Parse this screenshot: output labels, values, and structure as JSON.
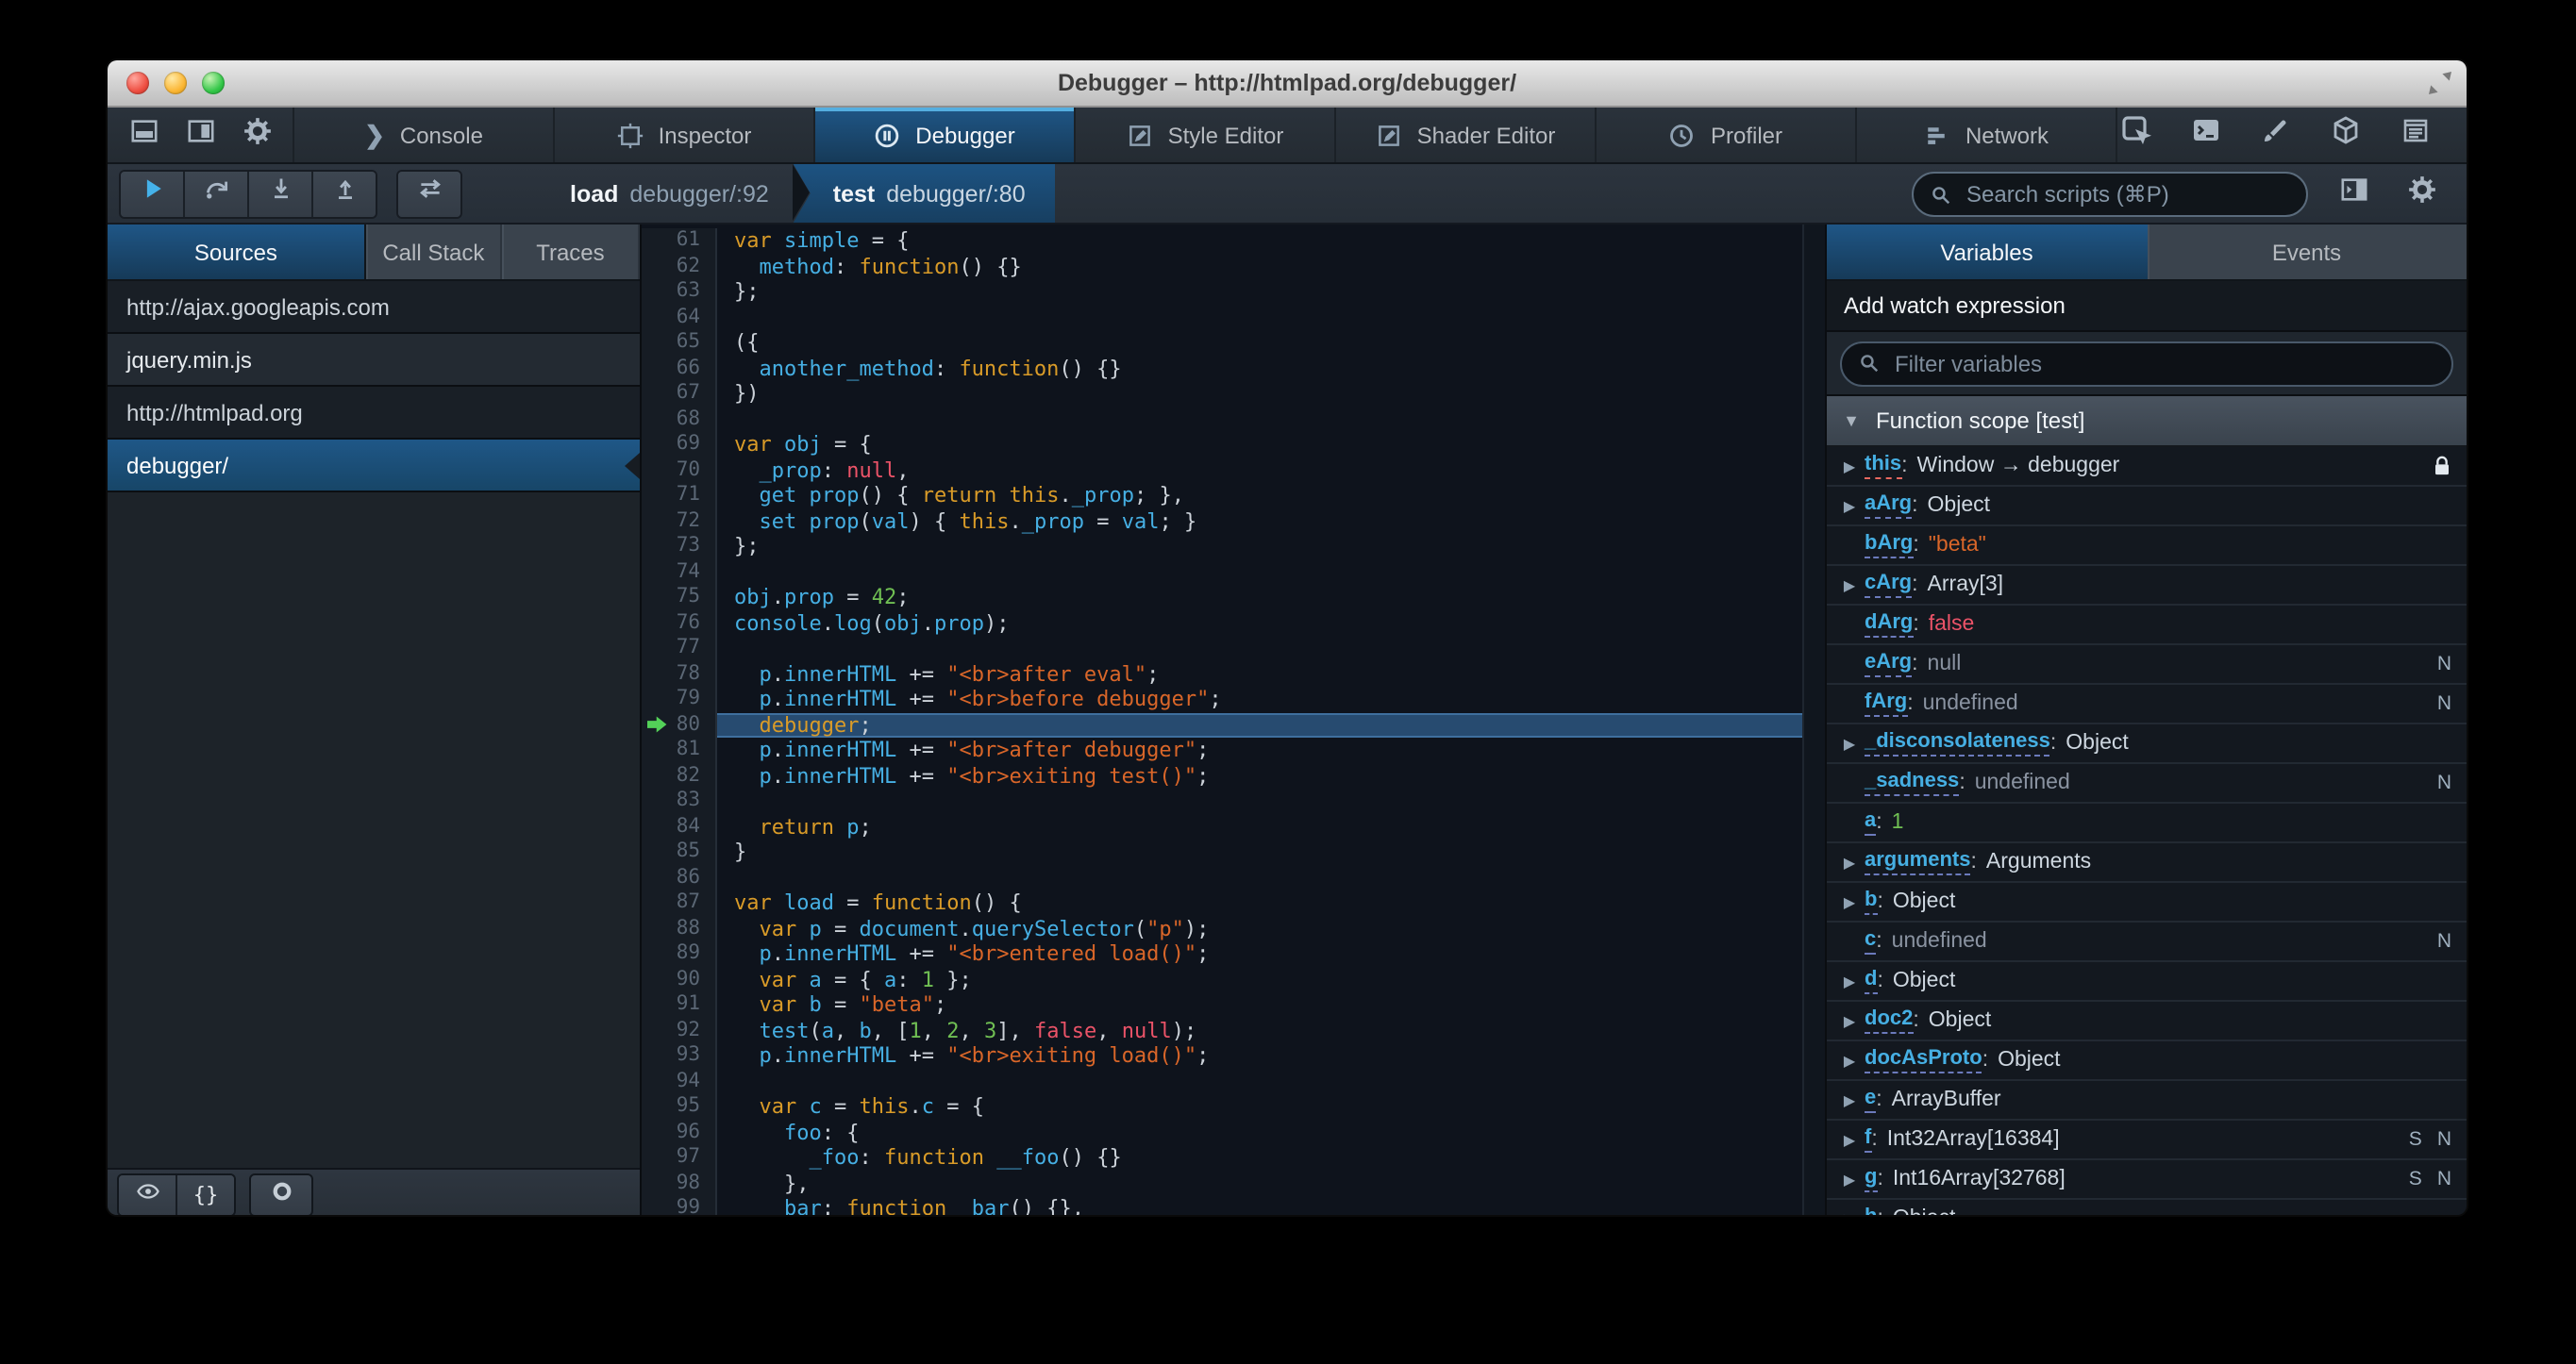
{
  "window": {
    "title": "Debugger – http://htmlpad.org/debugger/",
    "controls": [
      "close",
      "minimize",
      "zoom"
    ]
  },
  "colors": {
    "accent_blue": "#46afe3",
    "selection_blue": "#1d4f73",
    "keyword": "#d99b28",
    "string": "#d96629",
    "number": "#70bf53",
    "atom_red": "#eb5368",
    "ui_text": "#b6babf",
    "exec_arrow_green": "#53d158",
    "toolbar_bg": "#252c33",
    "editor_bg": "#0e131c"
  },
  "toolbar": {
    "left_icons": [
      "dock-bottom-icon",
      "dock-side-icon",
      "gear-icon"
    ],
    "tabs": [
      {
        "label": "Console",
        "icon": "console-icon"
      },
      {
        "label": "Inspector",
        "icon": "inspector-icon"
      },
      {
        "label": "Debugger",
        "icon": "debugger-icon"
      },
      {
        "label": "Style Editor",
        "icon": "style-editor-icon"
      },
      {
        "label": "Shader Editor",
        "icon": "shader-editor-icon"
      },
      {
        "label": "Profiler",
        "icon": "profiler-icon"
      },
      {
        "label": "Network",
        "icon": "network-icon"
      }
    ],
    "active_tab": "Debugger",
    "right_icons": [
      "pick-element-icon",
      "console-panel-icon",
      "paintbrush-icon",
      "tilt-3d-icon",
      "scratchpad-icon",
      "responsive-mode-icon"
    ]
  },
  "debugger_toolbar": {
    "buttons": [
      {
        "name": "resume-button",
        "icon": "resume-icon"
      },
      {
        "name": "step-over-button",
        "icon": "step-over-icon"
      },
      {
        "name": "step-in-button",
        "icon": "step-in-icon"
      },
      {
        "name": "step-out-button",
        "icon": "step-out-icon"
      }
    ],
    "trace_button": {
      "name": "trace-button",
      "icon": "trace-icon"
    },
    "breadcrumbs": [
      {
        "function": "load",
        "location": "debugger/:92",
        "active": false
      },
      {
        "function": "test",
        "location": "debugger/:80",
        "active": true
      }
    ],
    "search_placeholder": "Search scripts (⌘P)",
    "right_icons": [
      "toggle-panes-icon",
      "gear-icon"
    ]
  },
  "sources_panel": {
    "tabs": [
      "Sources",
      "Call Stack",
      "Traces"
    ],
    "active_tab": "Sources",
    "items": [
      {
        "label": "http://ajax.googleapis.com",
        "type": "group",
        "selected": false
      },
      {
        "label": "jquery.min.js",
        "type": "file",
        "selected": false
      },
      {
        "label": "http://htmlpad.org",
        "type": "group",
        "selected": false
      },
      {
        "label": "debugger/",
        "type": "file",
        "selected": true
      }
    ],
    "footer_icons": [
      "eye-icon",
      "pretty-print-icon",
      "toggle-breakpoints-icon"
    ]
  },
  "editor": {
    "current_line": 80,
    "lines": [
      {
        "n": 61,
        "t": [
          [
            "kw",
            "var"
          ],
          [
            "pn",
            " "
          ],
          [
            "id",
            "simple"
          ],
          [
            "pn",
            " = {"
          ]
        ]
      },
      {
        "n": 62,
        "t": [
          [
            "pn",
            "  "
          ],
          [
            "id",
            "method"
          ],
          [
            "pn",
            ": "
          ],
          [
            "kw",
            "function"
          ],
          [
            "pn",
            "() {}"
          ]
        ]
      },
      {
        "n": 63,
        "t": [
          [
            "pn",
            "};"
          ]
        ]
      },
      {
        "n": 64,
        "t": []
      },
      {
        "n": 65,
        "t": [
          [
            "pn",
            "({"
          ]
        ]
      },
      {
        "n": 66,
        "t": [
          [
            "pn",
            "  "
          ],
          [
            "id",
            "another_method"
          ],
          [
            "pn",
            ": "
          ],
          [
            "kw",
            "function"
          ],
          [
            "pn",
            "() {}"
          ]
        ]
      },
      {
        "n": 67,
        "t": [
          [
            "pn",
            "})"
          ]
        ]
      },
      {
        "n": 68,
        "t": []
      },
      {
        "n": 69,
        "t": [
          [
            "kw",
            "var"
          ],
          [
            "pn",
            " "
          ],
          [
            "id",
            "obj"
          ],
          [
            "pn",
            " = {"
          ]
        ]
      },
      {
        "n": 70,
        "t": [
          [
            "pn",
            "  "
          ],
          [
            "id",
            "_prop"
          ],
          [
            "pn",
            ": "
          ],
          [
            "at",
            "null"
          ],
          [
            "pn",
            ","
          ]
        ]
      },
      {
        "n": 71,
        "t": [
          [
            "pn",
            "  "
          ],
          [
            "id",
            "get prop"
          ],
          [
            "pn",
            "() { "
          ],
          [
            "kw",
            "return"
          ],
          [
            "pn",
            " "
          ],
          [
            "kw",
            "this"
          ],
          [
            "pn",
            "."
          ],
          [
            "id",
            "_prop"
          ],
          [
            "pn",
            "; },"
          ]
        ]
      },
      {
        "n": 72,
        "t": [
          [
            "pn",
            "  "
          ],
          [
            "id",
            "set prop"
          ],
          [
            "pn",
            "("
          ],
          [
            "id",
            "val"
          ],
          [
            "pn",
            ") { "
          ],
          [
            "kw",
            "this"
          ],
          [
            "pn",
            "."
          ],
          [
            "id",
            "_prop"
          ],
          [
            "pn",
            " = "
          ],
          [
            "id",
            "val"
          ],
          [
            "pn",
            "; }"
          ]
        ]
      },
      {
        "n": 73,
        "t": [
          [
            "pn",
            "};"
          ]
        ]
      },
      {
        "n": 74,
        "t": []
      },
      {
        "n": 75,
        "t": [
          [
            "id",
            "obj"
          ],
          [
            "pn",
            "."
          ],
          [
            "id",
            "prop"
          ],
          [
            "pn",
            " = "
          ],
          [
            "nu",
            "42"
          ],
          [
            "pn",
            ";"
          ]
        ]
      },
      {
        "n": 76,
        "t": [
          [
            "id",
            "console"
          ],
          [
            "pn",
            "."
          ],
          [
            "id",
            "log"
          ],
          [
            "pn",
            "("
          ],
          [
            "id",
            "obj"
          ],
          [
            "pn",
            "."
          ],
          [
            "id",
            "prop"
          ],
          [
            "pn",
            ");"
          ]
        ]
      },
      {
        "n": 77,
        "t": []
      },
      {
        "n": 78,
        "t": [
          [
            "pn",
            "  "
          ],
          [
            "id",
            "p"
          ],
          [
            "pn",
            "."
          ],
          [
            "id",
            "innerHTML"
          ],
          [
            "pn",
            " += "
          ],
          [
            "st",
            "\"<br>after eval\""
          ],
          [
            "pn",
            ";"
          ]
        ]
      },
      {
        "n": 79,
        "t": [
          [
            "pn",
            "  "
          ],
          [
            "id",
            "p"
          ],
          [
            "pn",
            "."
          ],
          [
            "id",
            "innerHTML"
          ],
          [
            "pn",
            " += "
          ],
          [
            "st",
            "\"<br>before debugger\""
          ],
          [
            "pn",
            ";"
          ]
        ]
      },
      {
        "n": 80,
        "t": [
          [
            "pn",
            "  "
          ],
          [
            "kw",
            "debugger"
          ],
          [
            "pn",
            ";"
          ]
        ]
      },
      {
        "n": 81,
        "t": [
          [
            "pn",
            "  "
          ],
          [
            "id",
            "p"
          ],
          [
            "pn",
            "."
          ],
          [
            "id",
            "innerHTML"
          ],
          [
            "pn",
            " += "
          ],
          [
            "st",
            "\"<br>after debugger\""
          ],
          [
            "pn",
            ";"
          ]
        ]
      },
      {
        "n": 82,
        "t": [
          [
            "pn",
            "  "
          ],
          [
            "id",
            "p"
          ],
          [
            "pn",
            "."
          ],
          [
            "id",
            "innerHTML"
          ],
          [
            "pn",
            " += "
          ],
          [
            "st",
            "\"<br>exiting test()\""
          ],
          [
            "pn",
            ";"
          ]
        ]
      },
      {
        "n": 83,
        "t": []
      },
      {
        "n": 84,
        "t": [
          [
            "pn",
            "  "
          ],
          [
            "kw",
            "return"
          ],
          [
            "pn",
            " "
          ],
          [
            "id",
            "p"
          ],
          [
            "pn",
            ";"
          ]
        ]
      },
      {
        "n": 85,
        "t": [
          [
            "pn",
            "}"
          ]
        ]
      },
      {
        "n": 86,
        "t": []
      },
      {
        "n": 87,
        "t": [
          [
            "kw",
            "var"
          ],
          [
            "pn",
            " "
          ],
          [
            "id",
            "load"
          ],
          [
            "pn",
            " = "
          ],
          [
            "kw",
            "function"
          ],
          [
            "pn",
            "() {"
          ]
        ]
      },
      {
        "n": 88,
        "t": [
          [
            "pn",
            "  "
          ],
          [
            "kw",
            "var"
          ],
          [
            "pn",
            " "
          ],
          [
            "id",
            "p"
          ],
          [
            "pn",
            " = "
          ],
          [
            "id",
            "document"
          ],
          [
            "pn",
            "."
          ],
          [
            "id",
            "querySelector"
          ],
          [
            "pn",
            "("
          ],
          [
            "st",
            "\"p\""
          ],
          [
            "pn",
            ");"
          ]
        ]
      },
      {
        "n": 89,
        "t": [
          [
            "pn",
            "  "
          ],
          [
            "id",
            "p"
          ],
          [
            "pn",
            "."
          ],
          [
            "id",
            "innerHTML"
          ],
          [
            "pn",
            " += "
          ],
          [
            "st",
            "\"<br>entered load()\""
          ],
          [
            "pn",
            ";"
          ]
        ]
      },
      {
        "n": 90,
        "t": [
          [
            "pn",
            "  "
          ],
          [
            "kw",
            "var"
          ],
          [
            "pn",
            " "
          ],
          [
            "id",
            "a"
          ],
          [
            "pn",
            " = { "
          ],
          [
            "id",
            "a"
          ],
          [
            "pn",
            ": "
          ],
          [
            "nu",
            "1"
          ],
          [
            "pn",
            " };"
          ]
        ]
      },
      {
        "n": 91,
        "t": [
          [
            "pn",
            "  "
          ],
          [
            "kw",
            "var"
          ],
          [
            "pn",
            " "
          ],
          [
            "id",
            "b"
          ],
          [
            "pn",
            " = "
          ],
          [
            "st",
            "\"beta\""
          ],
          [
            "pn",
            ";"
          ]
        ]
      },
      {
        "n": 92,
        "t": [
          [
            "pn",
            "  "
          ],
          [
            "id",
            "test"
          ],
          [
            "pn",
            "("
          ],
          [
            "id",
            "a"
          ],
          [
            "pn",
            ", "
          ],
          [
            "id",
            "b"
          ],
          [
            "pn",
            ", ["
          ],
          [
            "nu",
            "1"
          ],
          [
            "pn",
            ", "
          ],
          [
            "nu",
            "2"
          ],
          [
            "pn",
            ", "
          ],
          [
            "nu",
            "3"
          ],
          [
            "pn",
            "], "
          ],
          [
            "at",
            "false"
          ],
          [
            "pn",
            ", "
          ],
          [
            "at",
            "null"
          ],
          [
            "pn",
            ");"
          ]
        ]
      },
      {
        "n": 93,
        "t": [
          [
            "pn",
            "  "
          ],
          [
            "id",
            "p"
          ],
          [
            "pn",
            "."
          ],
          [
            "id",
            "innerHTML"
          ],
          [
            "pn",
            " += "
          ],
          [
            "st",
            "\"<br>exiting load()\""
          ],
          [
            "pn",
            ";"
          ]
        ]
      },
      {
        "n": 94,
        "t": []
      },
      {
        "n": 95,
        "t": [
          [
            "pn",
            "  "
          ],
          [
            "kw",
            "var"
          ],
          [
            "pn",
            " "
          ],
          [
            "id",
            "c"
          ],
          [
            "pn",
            " = "
          ],
          [
            "kw",
            "this"
          ],
          [
            "pn",
            "."
          ],
          [
            "id",
            "c"
          ],
          [
            "pn",
            " = {"
          ]
        ]
      },
      {
        "n": 96,
        "t": [
          [
            "pn",
            "    "
          ],
          [
            "id",
            "foo"
          ],
          [
            "pn",
            ": {"
          ]
        ]
      },
      {
        "n": 97,
        "t": [
          [
            "pn",
            "      "
          ],
          [
            "id",
            "_foo"
          ],
          [
            "pn",
            ": "
          ],
          [
            "kw",
            "function"
          ],
          [
            "pn",
            " "
          ],
          [
            "id",
            "__foo"
          ],
          [
            "pn",
            "() {}"
          ]
        ]
      },
      {
        "n": 98,
        "t": [
          [
            "pn",
            "    },"
          ]
        ]
      },
      {
        "n": 99,
        "t": [
          [
            "pn",
            "    "
          ],
          [
            "id",
            "bar"
          ],
          [
            "pn",
            ": "
          ],
          [
            "kw",
            "function"
          ],
          [
            "pn",
            " "
          ],
          [
            "id",
            "_bar"
          ],
          [
            "pn",
            "() {},"
          ]
        ]
      }
    ]
  },
  "variables_panel": {
    "tabs": [
      "Variables",
      "Events"
    ],
    "active_tab": "Variables",
    "watch_label": "Add watch expression",
    "filter_placeholder": "Filter variables",
    "scope": {
      "label": "Function scope [test]",
      "expanded": true,
      "variables": [
        {
          "name": "this",
          "value": "Window → debugger",
          "vclass": "obj",
          "arrow": true,
          "lock": true,
          "underline": "red"
        },
        {
          "name": "aArg",
          "value": "Object",
          "vclass": "obj",
          "arrow": true
        },
        {
          "name": "bArg",
          "value": "\"beta\"",
          "vclass": "str"
        },
        {
          "name": "cArg",
          "value": "Array[3]",
          "vclass": "obj",
          "arrow": true
        },
        {
          "name": "dArg",
          "value": "false",
          "vclass": "atom"
        },
        {
          "name": "eArg",
          "value": "null",
          "vclass": "und",
          "badges": [
            "N"
          ]
        },
        {
          "name": "fArg",
          "value": "undefined",
          "vclass": "und",
          "badges": [
            "N"
          ]
        },
        {
          "name": "_disconsolateness",
          "value": "Object",
          "vclass": "obj",
          "arrow": true
        },
        {
          "name": "_sadness",
          "value": "undefined",
          "vclass": "und",
          "badges": [
            "N"
          ]
        },
        {
          "name": "a",
          "value": "1",
          "vclass": "num"
        },
        {
          "name": "arguments",
          "value": "Arguments",
          "vclass": "obj",
          "arrow": true
        },
        {
          "name": "b",
          "value": "Object",
          "vclass": "obj",
          "arrow": true
        },
        {
          "name": "c",
          "value": "undefined",
          "vclass": "und",
          "badges": [
            "N"
          ]
        },
        {
          "name": "d",
          "value": "Object",
          "vclass": "obj",
          "arrow": true
        },
        {
          "name": "doc2",
          "value": "Object",
          "vclass": "obj",
          "arrow": true
        },
        {
          "name": "docAsProto",
          "value": "Object",
          "vclass": "obj",
          "arrow": true
        },
        {
          "name": "e",
          "value": "ArrayBuffer",
          "vclass": "obj",
          "arrow": true
        },
        {
          "name": "f",
          "value": "Int32Array[16384]",
          "vclass": "obj",
          "arrow": true,
          "badges": [
            "S",
            "N"
          ]
        },
        {
          "name": "g",
          "value": "Int16Array[32768]",
          "vclass": "obj",
          "arrow": true,
          "badges": [
            "S",
            "N"
          ]
        },
        {
          "name": "h",
          "value": "Object",
          "vclass": "obj",
          "arrow": true
        }
      ]
    }
  }
}
